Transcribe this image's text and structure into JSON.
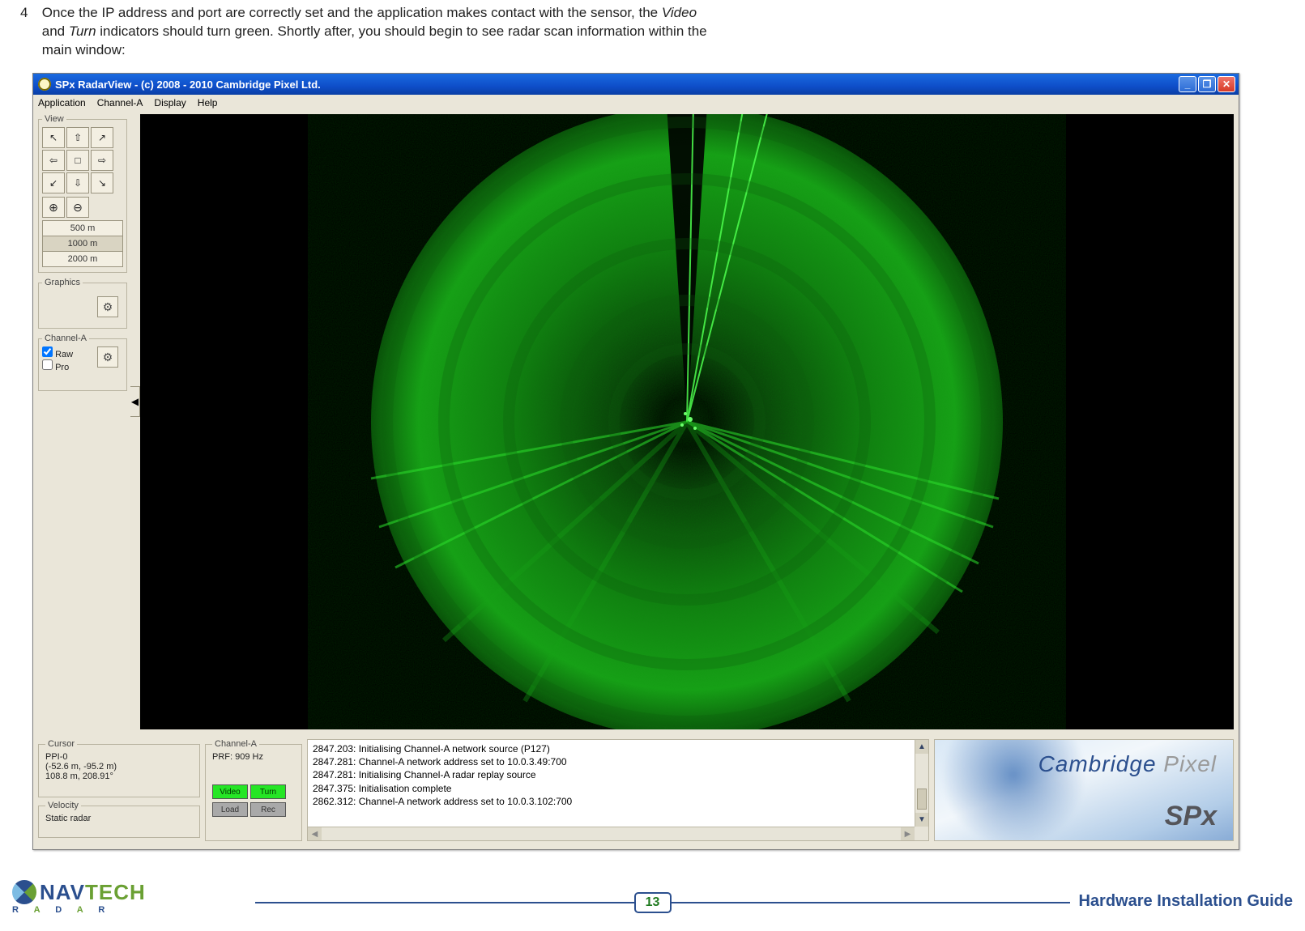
{
  "doc": {
    "step_number": "4",
    "text_before_video": "Once the IP address and port are correctly set and the application makes contact with the sensor, the ",
    "video_word": "Video",
    "text_mid": " and ",
    "turn_word": "Turn",
    "text_after": " indicators should turn green. Shortly after, you should begin to see radar scan information within the main window:"
  },
  "window": {
    "title": "SPx RadarView - (c) 2008 - 2010 Cambridge Pixel Ltd.",
    "min_btn": "_",
    "max_btn": "❐",
    "close_btn": "✕",
    "menus": [
      "Application",
      "Channel-A",
      "Display",
      "Help"
    ]
  },
  "view_panel": {
    "legend": "View",
    "arrows": [
      "↖",
      "⇧",
      "↗",
      "⇦",
      "□",
      "⇨",
      "↙",
      "⇩",
      "↘"
    ],
    "ranges": [
      "500 m",
      "1000 m",
      "2000 m"
    ],
    "selected_range": "1000 m"
  },
  "graphics_panel": {
    "legend": "Graphics"
  },
  "channel_a_panel": {
    "legend": "Channel-A",
    "raw_label": "Raw",
    "pro_label": "Pro",
    "raw_checked": true,
    "pro_checked": false
  },
  "side_tab": "◀",
  "status": {
    "cursor": {
      "legend": "Cursor",
      "line1": "PPI-0",
      "line2": "(-52.6 m, -95.2 m)",
      "line3": "108.8 m, 208.91°"
    },
    "velocity": {
      "legend": "Velocity",
      "line1": "Static radar"
    },
    "channel_a": {
      "legend": "Channel-A",
      "prf": "PRF: 909 Hz",
      "indicators": {
        "video": "Video",
        "turn": "Turn",
        "load": "Load",
        "rec": "Rec"
      }
    },
    "log_lines": [
      "2847.203: Initialising Channel-A network source (P127)",
      "2847.281: Channel-A network address set to 10.0.3.49:700",
      "2847.281: Initialising Channel-A radar replay source",
      "2847.375: Initialisation complete",
      "2862.312: Channel-A network address set to 10.0.3.102:700"
    ],
    "brand": {
      "cambridge": "Cambridge",
      "pixel": "Pixel",
      "spx": "SPx"
    }
  },
  "footer": {
    "page_number": "13",
    "guide_title": "Hardware Installation Guide",
    "logo": {
      "nav": "NAV",
      "tech": "TECH",
      "sub": "R A D A R"
    }
  }
}
